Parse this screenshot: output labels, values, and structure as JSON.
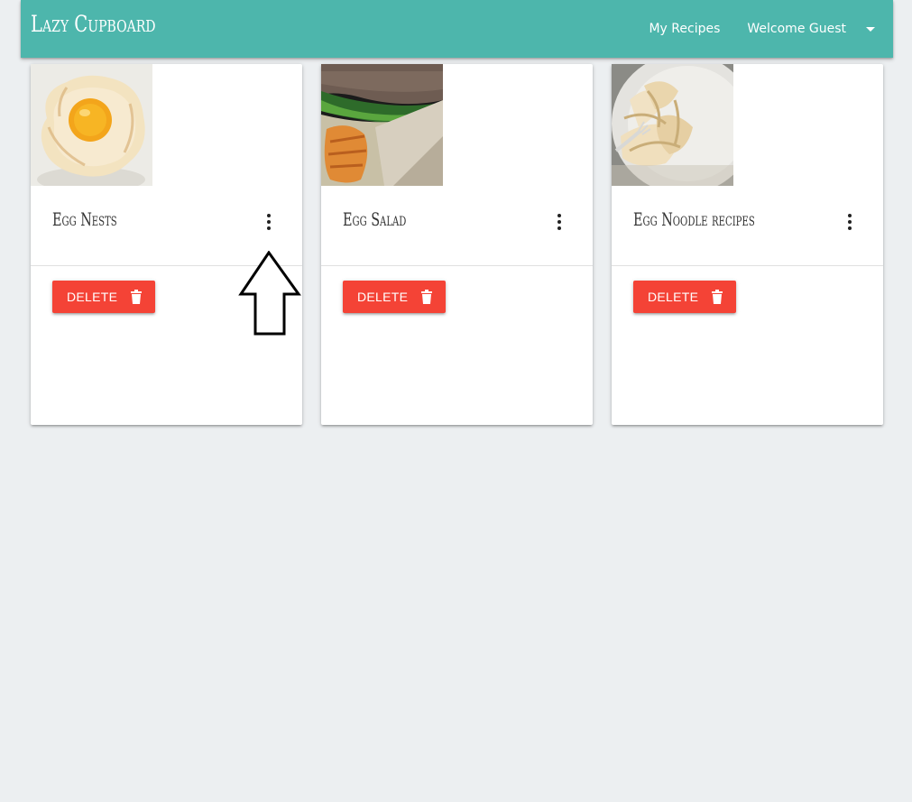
{
  "navbar": {
    "brand": "Lazy Cupboard",
    "links": {
      "my_recipes": "My Recipes",
      "user_menu": "Welcome Guest"
    },
    "color": "#4db6ac"
  },
  "cards": [
    {
      "title": "Egg Nests",
      "delete_label": "DELETE",
      "menu_icon": "more-vert-icon",
      "delete_icon": "trash-icon"
    },
    {
      "title": "Egg Salad",
      "delete_label": "DELETE",
      "menu_icon": "more-vert-icon",
      "delete_icon": "trash-icon"
    },
    {
      "title": "Egg Noodle recipes",
      "delete_label": "DELETE",
      "menu_icon": "more-vert-icon",
      "delete_icon": "trash-icon"
    }
  ],
  "colors": {
    "accent": "#4db6ac",
    "danger": "#f44336",
    "background": "#eceff1"
  }
}
